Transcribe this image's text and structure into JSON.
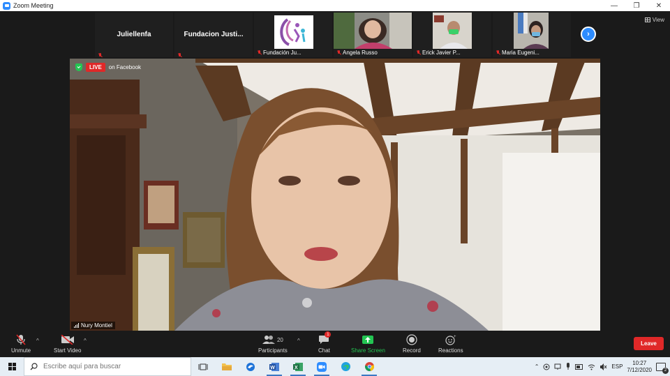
{
  "window": {
    "title": "Zoom Meeting",
    "controls": {
      "minimize": "—",
      "restore": "❐",
      "close": "✕"
    }
  },
  "view_button": {
    "label": "View"
  },
  "participants_strip": [
    {
      "name": "Juliellenfa",
      "type": "name-only"
    },
    {
      "name": "Fundacion  Justi...",
      "type": "name-only"
    },
    {
      "name": "Fundación Ju...",
      "type": "logo"
    },
    {
      "name": "Angela Russo",
      "type": "video"
    },
    {
      "name": "Erick Javier P...",
      "type": "video"
    },
    {
      "name": "Maria Eugeni...",
      "type": "video"
    }
  ],
  "live": {
    "badge": "LIVE",
    "destination": "on Facebook"
  },
  "main_speaker": {
    "name": "Nury Montiel"
  },
  "toolbar": {
    "unmute": "Unmute",
    "start_video": "Start Video",
    "participants": "Participants",
    "participants_count": "20",
    "chat": "Chat",
    "chat_badge": "1",
    "share_screen": "Share Screen",
    "record": "Record",
    "reactions": "Reactions",
    "leave": "Leave"
  },
  "taskbar": {
    "search_placeholder": "Escribe aquí para buscar",
    "language": "ESP",
    "time": "10:27",
    "date": "7/12/2020",
    "notifications": "2"
  },
  "colors": {
    "accent": "#2d8cff",
    "live_red": "#e02828",
    "share_green": "#23c552",
    "taskbar_bg": "#e6eef5"
  }
}
